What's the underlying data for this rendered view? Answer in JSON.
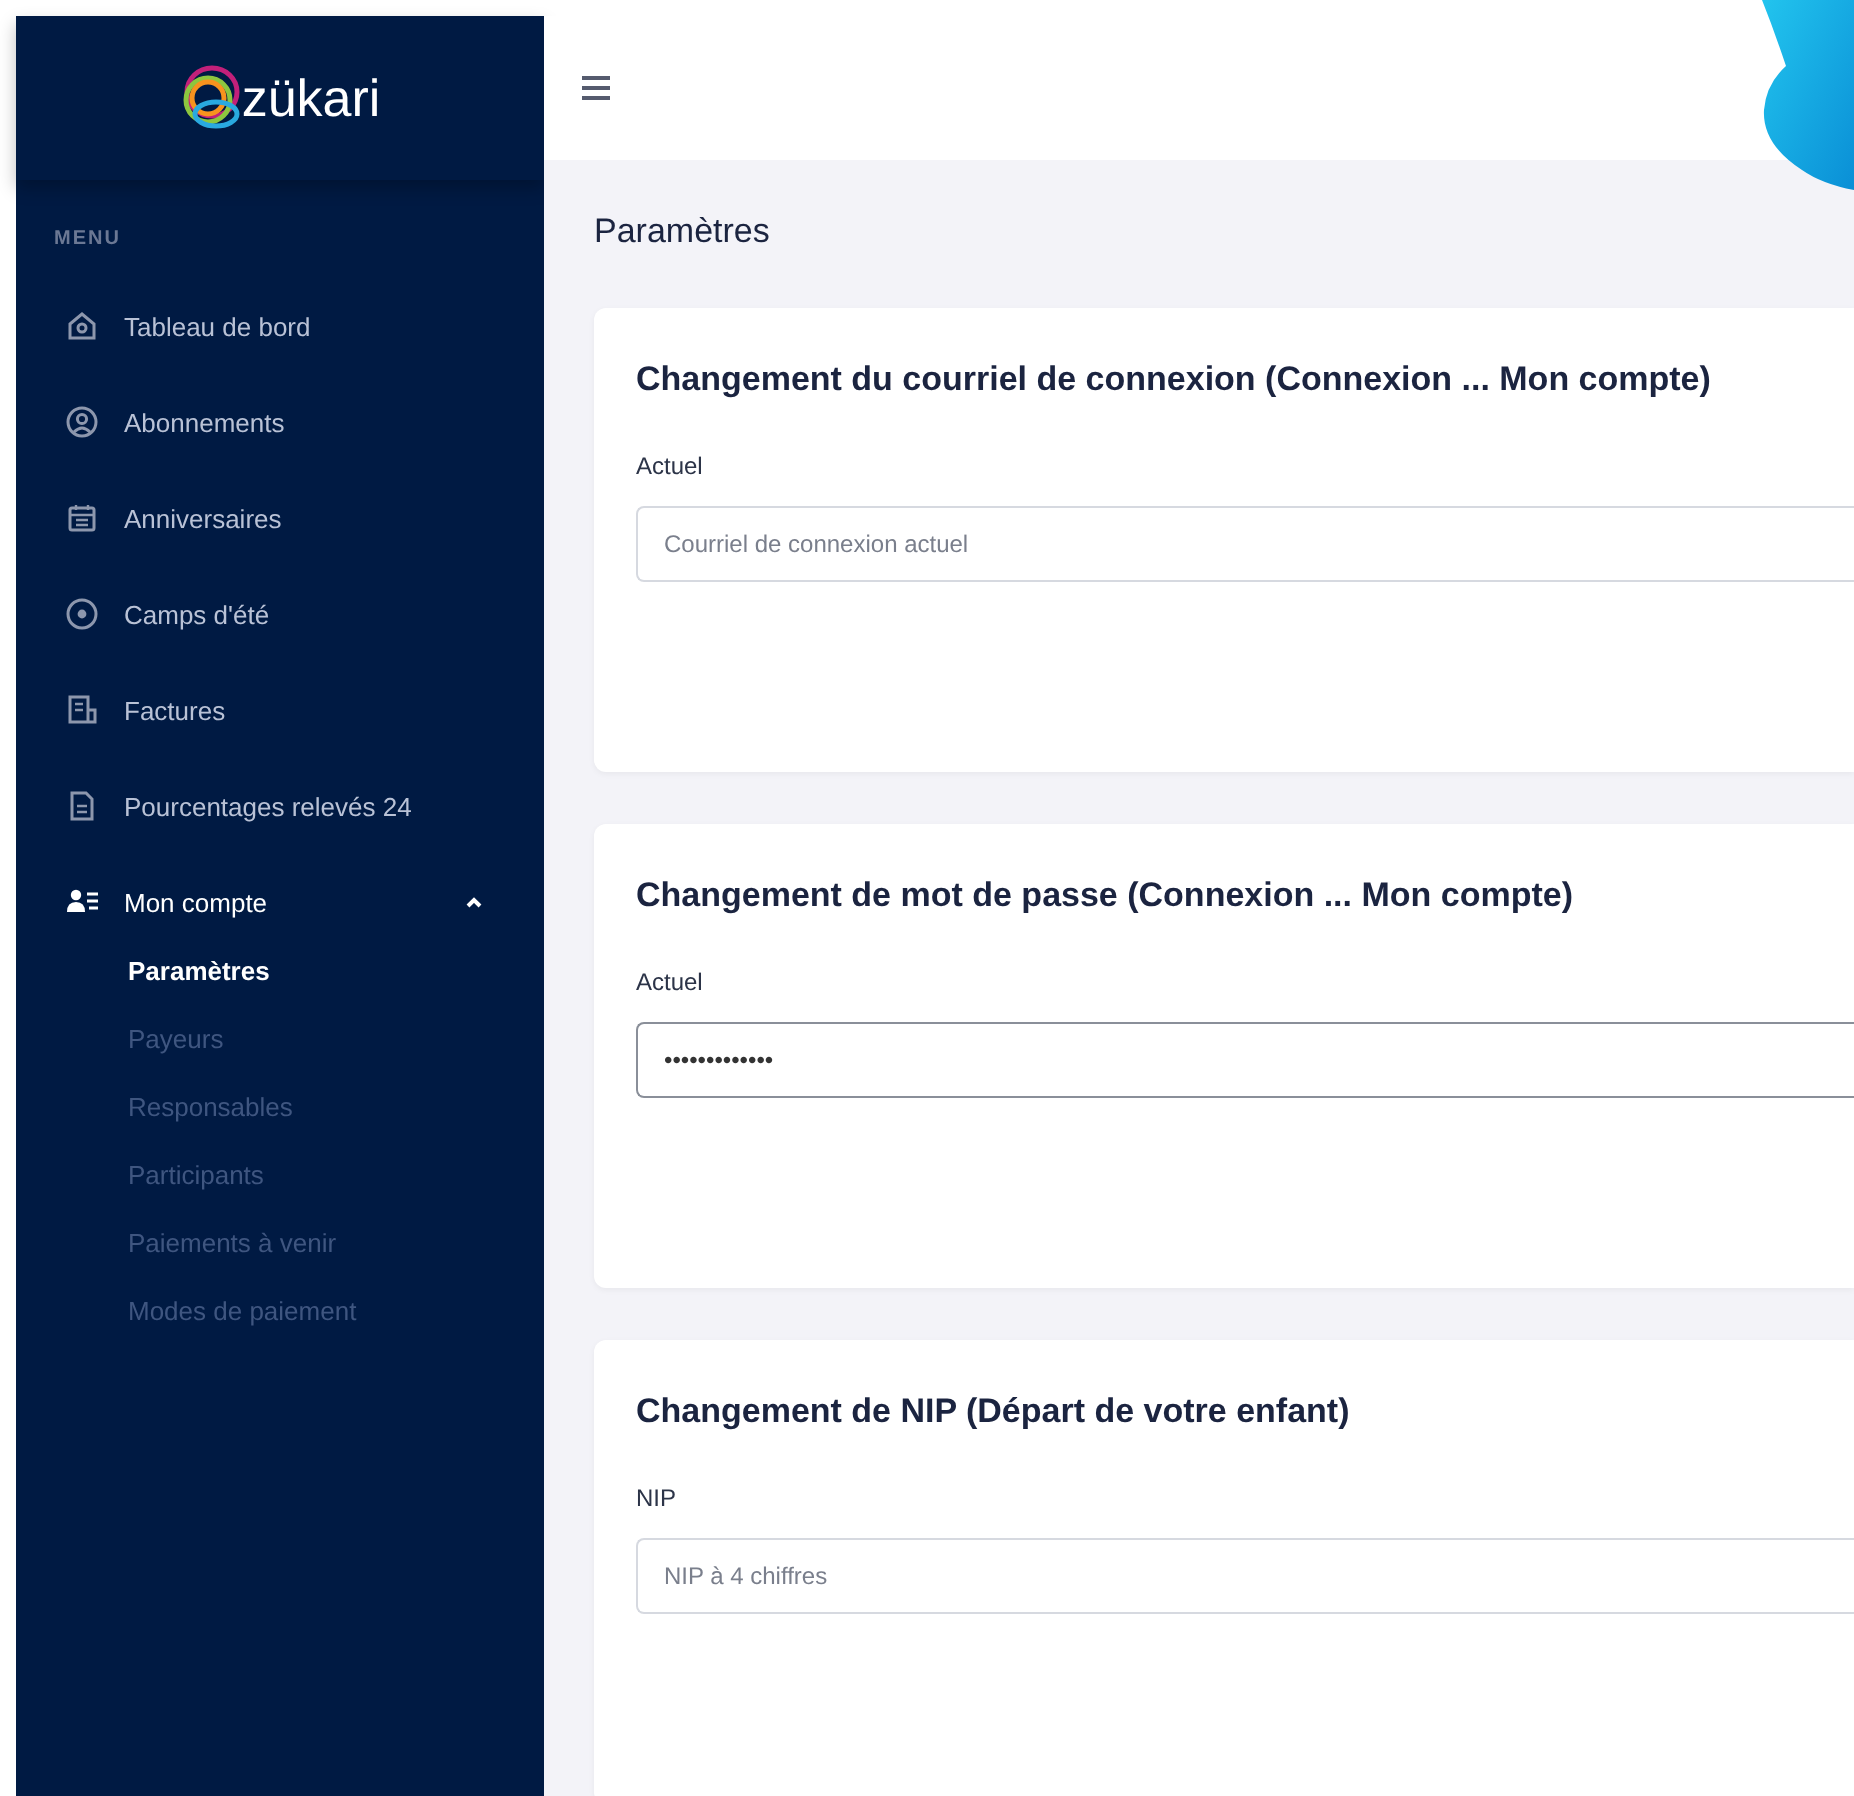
{
  "sidebar": {
    "logo": "zükari",
    "section_label": "MENU",
    "items": [
      {
        "kind": "link",
        "label": "Tableau de bord"
      },
      {
        "kind": "link",
        "label": "Abonnements"
      },
      {
        "kind": "link",
        "label": "Anniversaires"
      },
      {
        "kind": "link",
        "label": "Camps d'été"
      },
      {
        "kind": "link",
        "label": "Factures"
      },
      {
        "kind": "link",
        "label": "Pourcentages relevés 24"
      },
      {
        "kind": "group",
        "label": "Mon compte",
        "expanded": true,
        "children": [
          {
            "label": "Paramètres",
            "selected": true
          },
          {
            "label": "Payeurs",
            "selected": false
          },
          {
            "label": "Responsables",
            "selected": false
          },
          {
            "label": "Participants",
            "selected": false
          },
          {
            "label": "Paiements à venir",
            "selected": false
          },
          {
            "label": "Modes de paiement",
            "selected": false
          }
        ]
      }
    ]
  },
  "page": {
    "title": "Paramètres"
  },
  "cards": [
    {
      "title": "Changement du courriel de connexion (Connexion ... Mon compte)",
      "field_label": "Actuel",
      "placeholder": "Courriel de connexion actuel",
      "focused": false
    },
    {
      "title": "Changement de mot de passe (Connexion ... Mon compte)",
      "field_label": "Actuel",
      "value": "•••••••••••••",
      "focused": true
    },
    {
      "title": "Changement de NIP (Départ de votre enfant)",
      "field_label": "NIP",
      "placeholder": "NIP à 4 chiffres",
      "focused": false
    }
  ]
}
